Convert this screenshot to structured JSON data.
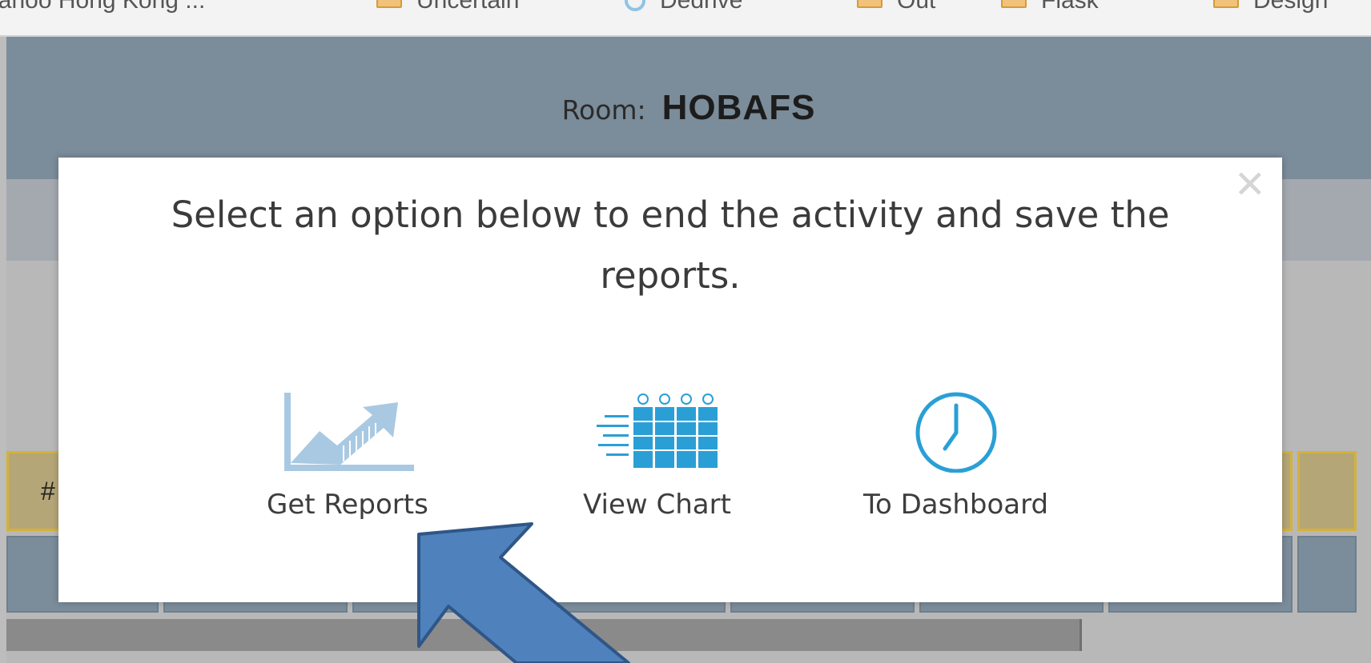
{
  "bookmarks": [
    {
      "label": "Yahoo Hong Kong ...",
      "icon": "none"
    },
    {
      "label": "Uncertain",
      "icon": "folder-icon"
    },
    {
      "label": "Dedrive",
      "icon": "gear-icon"
    },
    {
      "label": "Out",
      "icon": "folder-icon"
    },
    {
      "label": "Flask",
      "icon": "folder-icon"
    },
    {
      "label": "Design",
      "icon": "folder-icon"
    }
  ],
  "header": {
    "room_label": "Room:",
    "room_name": "HOBAFS"
  },
  "table": {
    "first_header": "#"
  },
  "modal": {
    "message": "Select an option below to end the activity and save the reports.",
    "close_symbol": "✕",
    "options": [
      {
        "label": "Get Reports",
        "icon": "growth-chart-icon"
      },
      {
        "label": "View Chart",
        "icon": "column-chart-icon"
      },
      {
        "label": "To Dashboard",
        "icon": "clock-icon"
      }
    ]
  },
  "colors": {
    "accent": "#2a9fd6",
    "header_bg": "#7b8c9a",
    "annotation_arrow": "#4f81bd"
  }
}
